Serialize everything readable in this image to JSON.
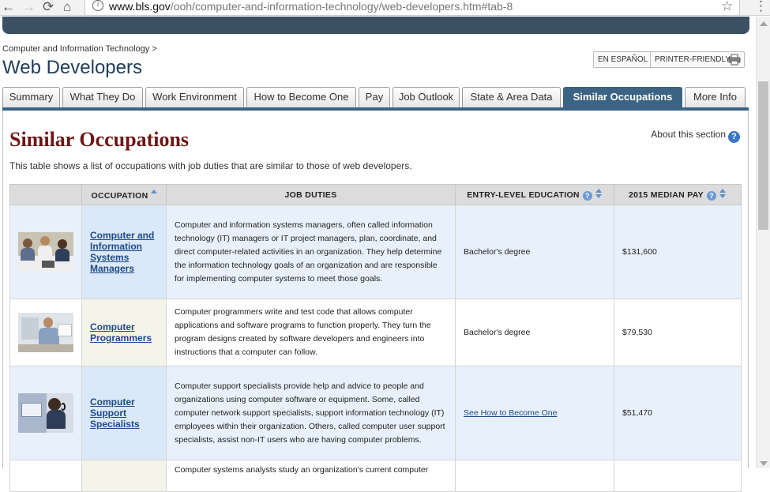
{
  "browser": {
    "back": "←",
    "forward": "→",
    "reload": "⟳",
    "home": "⌂",
    "url_host": "www.bls.gov",
    "url_path": "/ooh/computer-and-information-technology/web-developers.htm#tab-8",
    "star": "☆",
    "menu": "⋮"
  },
  "header": {
    "breadcrumb": "Computer and Information Technology >",
    "title": "Web Developers",
    "espanol": "EN ESPAÑOL",
    "printer": "PRINTER-FRIENDLY"
  },
  "tabs": [
    {
      "label": "Summary"
    },
    {
      "label": "What They Do"
    },
    {
      "label": "Work Environment"
    },
    {
      "label": "How to Become One"
    },
    {
      "label": "Pay"
    },
    {
      "label": "Job Outlook"
    },
    {
      "label": "State & Area Data"
    },
    {
      "label": "Similar Occupations",
      "active": true
    },
    {
      "label": "More Info"
    }
  ],
  "section": {
    "title": "Similar Occupations",
    "about": "About this section",
    "help": "?",
    "intro": "This table shows a list of occupations with job duties that are similar to those of web developers."
  },
  "table": {
    "headers": {
      "occupation": "OCCUPATION",
      "duties": "JOB DUTIES",
      "education": "ENTRY-LEVEL EDUCATION",
      "pay": "2015 MEDIAN PAY",
      "help": "?"
    },
    "rows": [
      {
        "name_lines": [
          "Computer and",
          "Information",
          "Systems",
          "Managers"
        ],
        "duties": "Computer and information systems managers, often called information technology (IT) managers or IT project managers, plan, coordinate, and direct computer-related activities in an organization. They help determine the information technology goals of an organization and are responsible for implementing computer systems to meet those goals.",
        "education": "Bachelor's degree",
        "pay": "$131,600"
      },
      {
        "name_lines": [
          "Computer",
          "Programmers"
        ],
        "duties": "Computer programmers write and test code that allows computer applications and software programs to function properly. They turn the program designs created by software developers and engineers into instructions that a computer can follow.",
        "education": "Bachelor's degree",
        "pay": "$79,530"
      },
      {
        "name_lines": [
          "Computer",
          "Support",
          "Specialists"
        ],
        "duties": "Computer support specialists provide help and advice to people and organizations using computer software or equipment. Some, called computer network support specialists, support information technology (IT) employees within their organization. Others, called computer user support specialists, assist non-IT users who are having computer problems.",
        "education_link": "See How to Become One",
        "pay": "$51,470"
      },
      {
        "duties": "Computer systems analysts study an organization's current computer"
      }
    ]
  }
}
